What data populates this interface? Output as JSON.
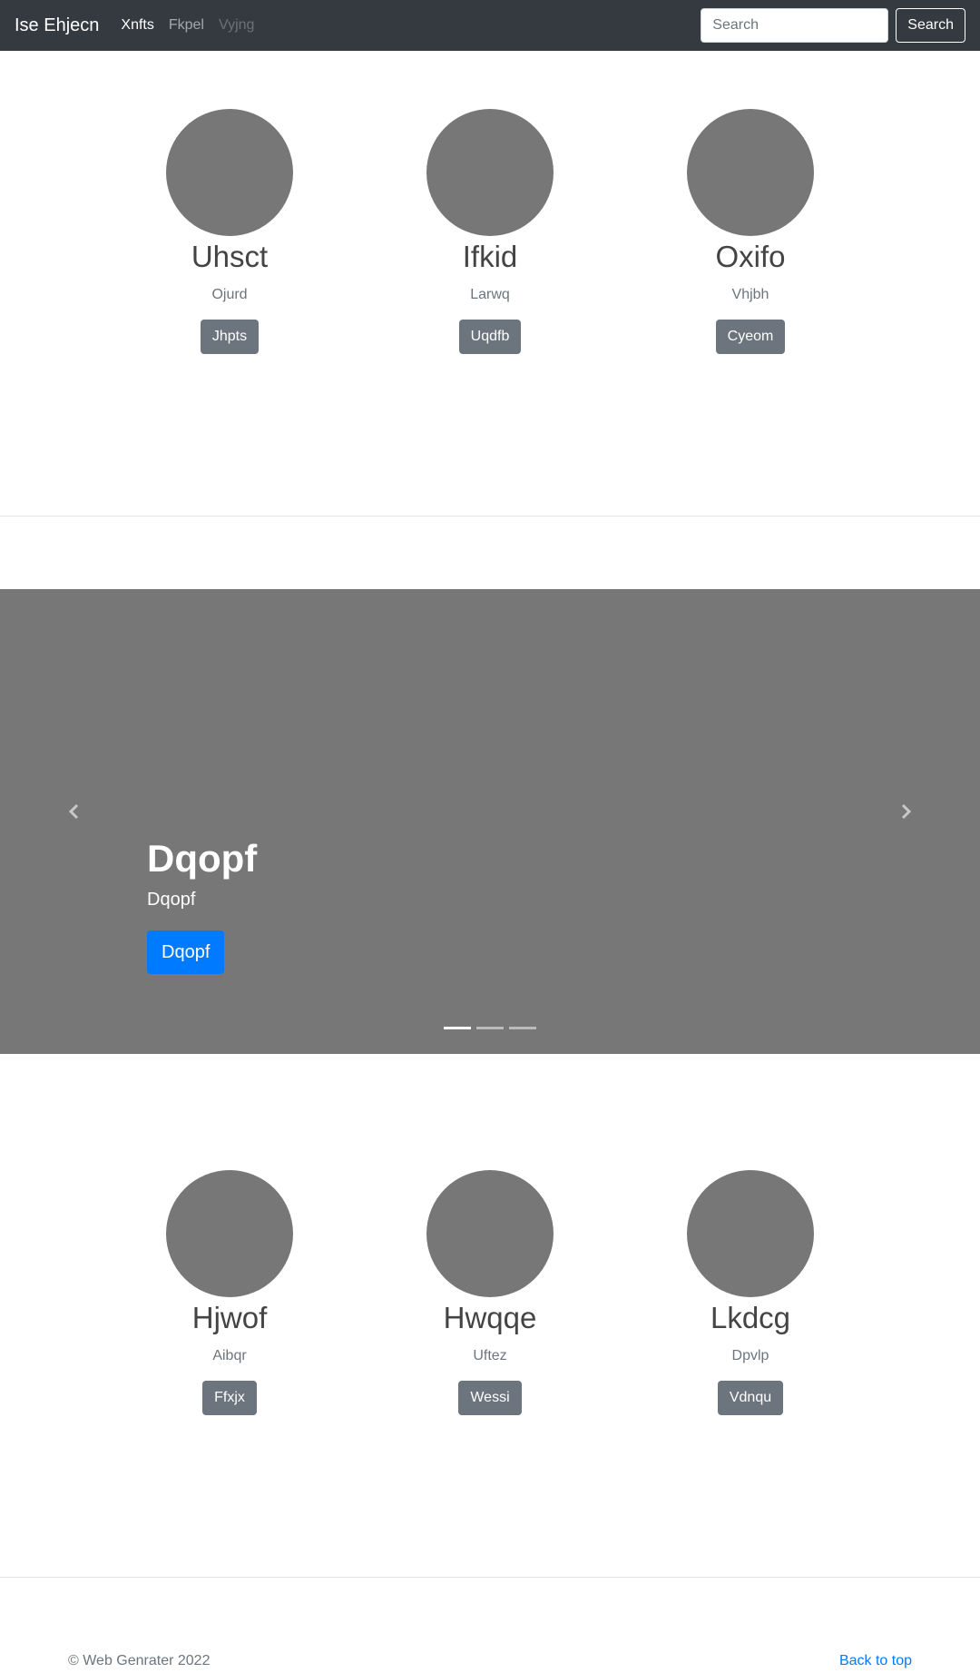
{
  "navbar": {
    "brand": "Ise Ehjecn",
    "links": [
      {
        "label": "Xnfts",
        "state": "active"
      },
      {
        "label": "Fkpel",
        "state": "normal"
      },
      {
        "label": "Vyjng",
        "state": "disabled"
      }
    ],
    "search_placeholder": "Search",
    "search_button": "Search"
  },
  "top_row": [
    {
      "name": "Uhsct",
      "subtitle": "Ojurd",
      "button": "Jhpts"
    },
    {
      "name": "Ifkid",
      "subtitle": "Larwq",
      "button": "Uqdfb"
    },
    {
      "name": "Oxifo",
      "subtitle": "Vhjbh",
      "button": "Cyeom"
    }
  ],
  "carousel": {
    "heading": "Dqopf",
    "subtitle": "Dqopf",
    "button": "Dqopf",
    "slide_count": 3,
    "active_slide": 1
  },
  "bottom_row": [
    {
      "name": "Hjwof",
      "subtitle": "Aibqr",
      "button": "Ffxjx"
    },
    {
      "name": "Hwqqe",
      "subtitle": "Uftez",
      "button": "Wessi"
    },
    {
      "name": "Lkdcg",
      "subtitle": "Dpvlp",
      "button": "Vdnqu"
    }
  ],
  "footer": {
    "copyright": "© Web Genrater 2022",
    "back_to_top": "Back to top"
  },
  "colors": {
    "navbar_bg": "#343a40",
    "placeholder_gray": "#777777",
    "secondary_button": "#6c757d",
    "primary_button": "#007bff"
  }
}
